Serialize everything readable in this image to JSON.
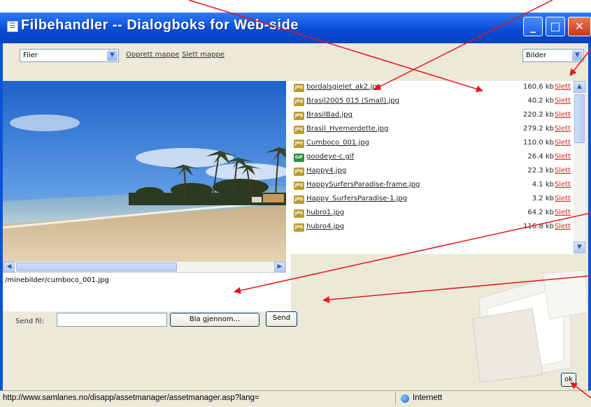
{
  "window": {
    "title": "Filbehandler -- Dialogboks for Web-side"
  },
  "toolbar": {
    "folder_select": "Filer",
    "create_folder": "Opprett mappe",
    "delete_folder": "Slett mappe",
    "type_select": "Bilder"
  },
  "preview": {
    "path": "/minebilder/cumboco_001.jpg"
  },
  "files": [
    {
      "name": "bordalsgjelet_ak2.jpg",
      "size": "160.6 kb",
      "type": "jpg"
    },
    {
      "name": "Brasil2005 015 (Small).jpg",
      "size": "40.2 kb",
      "type": "jpg"
    },
    {
      "name": "BrasilBad.jpg",
      "size": "220.2 kb",
      "type": "jpg"
    },
    {
      "name": "Brasil_Hvemerdette.jpg",
      "size": "279.2 kb",
      "type": "jpg"
    },
    {
      "name": "Cumboco_001.jpg",
      "size": "110.0 kb",
      "type": "jpg"
    },
    {
      "name": "goodeye-c.gif",
      "size": "26.4 kb",
      "type": "gif"
    },
    {
      "name": "Happy4.jpg",
      "size": "22.3 kb",
      "type": "jpg"
    },
    {
      "name": "HappySurfersParadise-frame.jpg",
      "size": "4.1 kb",
      "type": "jpg"
    },
    {
      "name": "Happy_SurfersParadise-1.jpg",
      "size": "3.2 kb",
      "type": "jpg"
    },
    {
      "name": "hubro1.jpg",
      "size": "64.2 kb",
      "type": "jpg"
    },
    {
      "name": "hubro4.jpg",
      "size": "116.8 kb",
      "type": "jpg"
    }
  ],
  "delete_label": "Slett",
  "upload": {
    "label": "Send fil:",
    "browse": "Bla gjennom...",
    "send": "Send"
  },
  "ok_label": "ok",
  "statusbar": {
    "url": "http://www.samlanes.no/disapp/assetmanager/assetmanager.asp?lang=",
    "zone": "Internett"
  },
  "colors": {
    "titlebar": "#0a53d6",
    "delete_link": "#e0201a",
    "annotation_arrow": "#e8141c"
  }
}
